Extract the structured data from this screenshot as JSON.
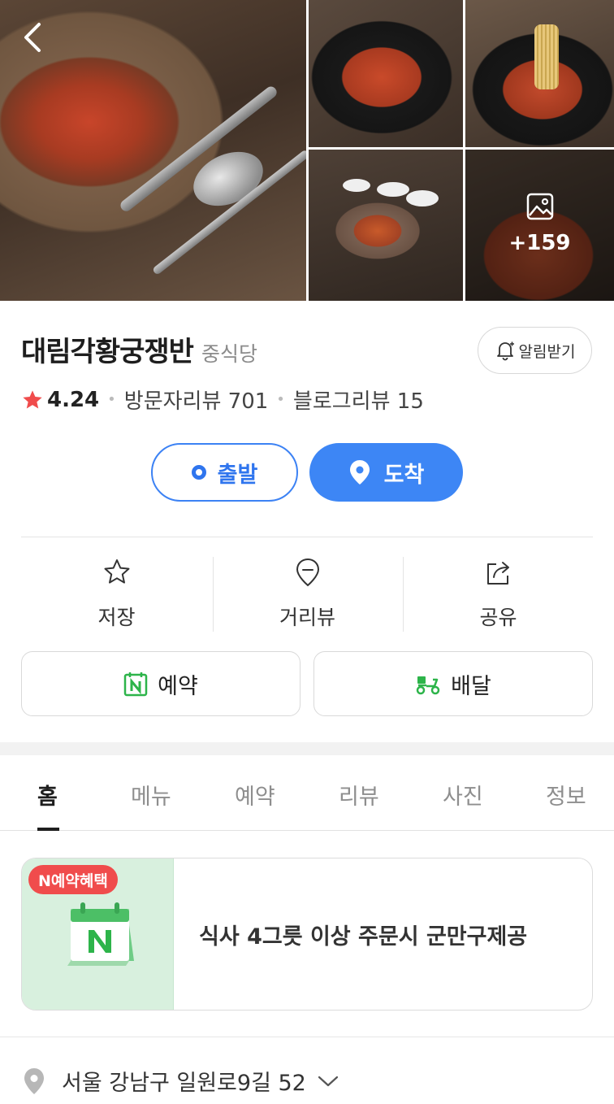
{
  "gallery": {
    "more_count": "+159"
  },
  "place": {
    "name": "대림각황궁쟁반",
    "category": "중식당",
    "alarm_label": "알림받기",
    "rating": "4.24",
    "visitor_review": "방문자리뷰 701",
    "blog_review": "블로그리뷰 15"
  },
  "route": {
    "depart": "출발",
    "arrive": "도착"
  },
  "actions": {
    "save": "저장",
    "street_view": "거리뷰",
    "share": "공유",
    "reserve": "예약",
    "delivery": "배달"
  },
  "tabs": [
    "홈",
    "메뉴",
    "예약",
    "리뷰",
    "사진",
    "정보"
  ],
  "promo": {
    "badge": "N예약혜택",
    "text": "식사 4그릇 이상 주문시 군만구제공"
  },
  "address": "서울 강남구 일원로9길 52",
  "colors": {
    "accent_blue": "#3d86f5",
    "star_red": "#f04c4c",
    "naver_green": "#2db44a",
    "promo_bg": "#d8f0de"
  }
}
